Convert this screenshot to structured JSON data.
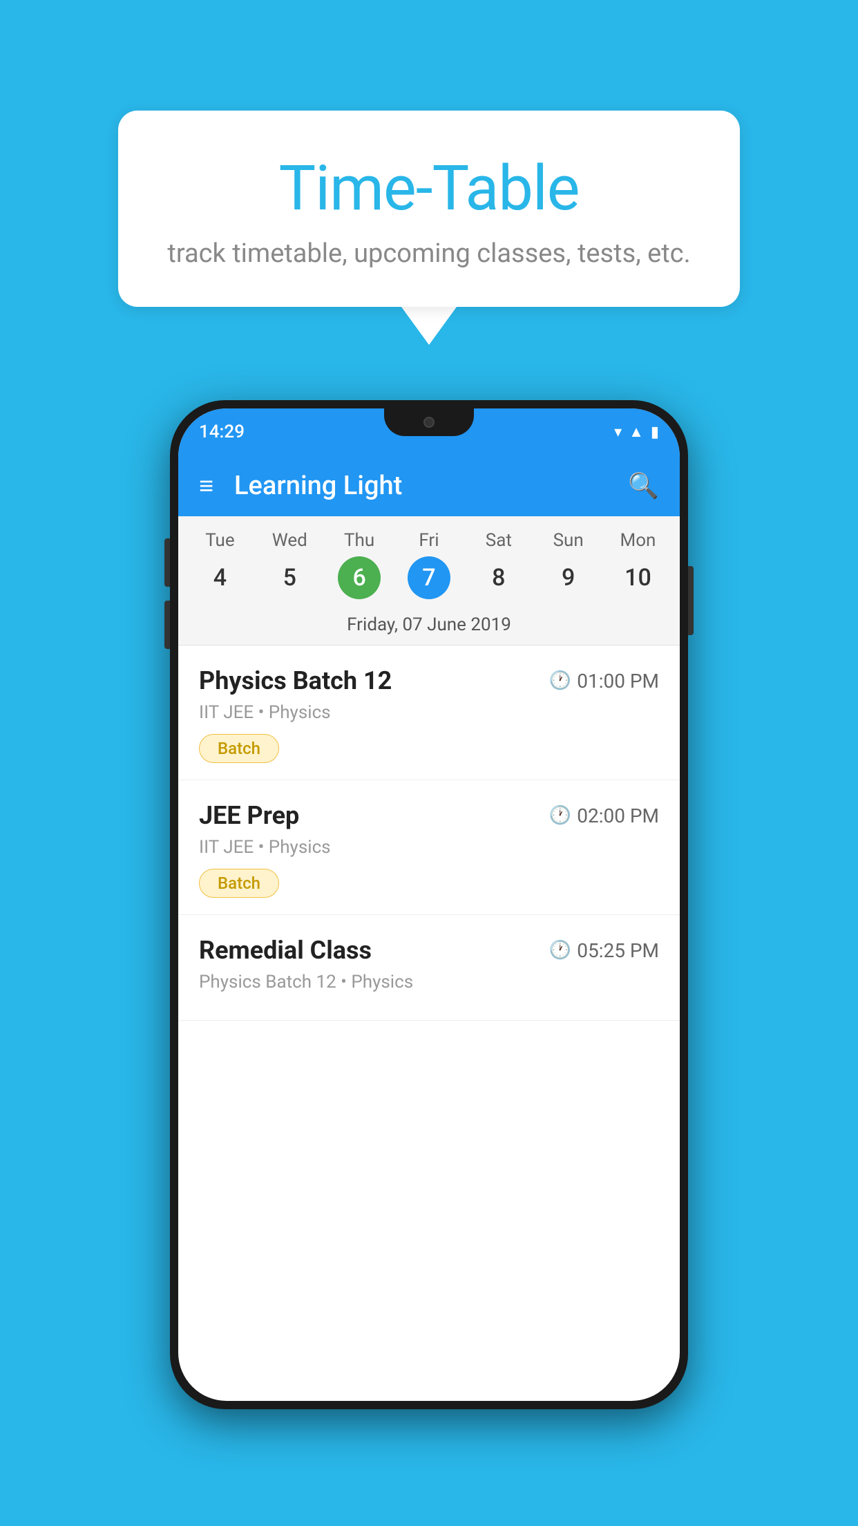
{
  "background": {
    "color": "#29b6e8"
  },
  "speech_bubble": {
    "title": "Time-Table",
    "subtitle": "track timetable, upcoming classes, tests, etc."
  },
  "app": {
    "title": "Learning Light"
  },
  "status_bar": {
    "time": "14:29"
  },
  "calendar": {
    "selected_date_label": "Friday, 07 June 2019",
    "days": [
      {
        "name": "Tue",
        "num": "4",
        "state": "normal"
      },
      {
        "name": "Wed",
        "num": "5",
        "state": "normal"
      },
      {
        "name": "Thu",
        "num": "6",
        "state": "today"
      },
      {
        "name": "Fri",
        "num": "7",
        "state": "selected"
      },
      {
        "name": "Sat",
        "num": "8",
        "state": "normal"
      },
      {
        "name": "Sun",
        "num": "9",
        "state": "normal"
      },
      {
        "name": "Mon",
        "num": "10",
        "state": "normal"
      }
    ]
  },
  "schedule": {
    "items": [
      {
        "title": "Physics Batch 12",
        "time": "01:00 PM",
        "sub": "IIT JEE • Physics",
        "badge": "Batch"
      },
      {
        "title": "JEE Prep",
        "time": "02:00 PM",
        "sub": "IIT JEE • Physics",
        "badge": "Batch"
      },
      {
        "title": "Remedial Class",
        "time": "05:25 PM",
        "sub": "Physics Batch 12 • Physics",
        "badge": null
      }
    ]
  }
}
